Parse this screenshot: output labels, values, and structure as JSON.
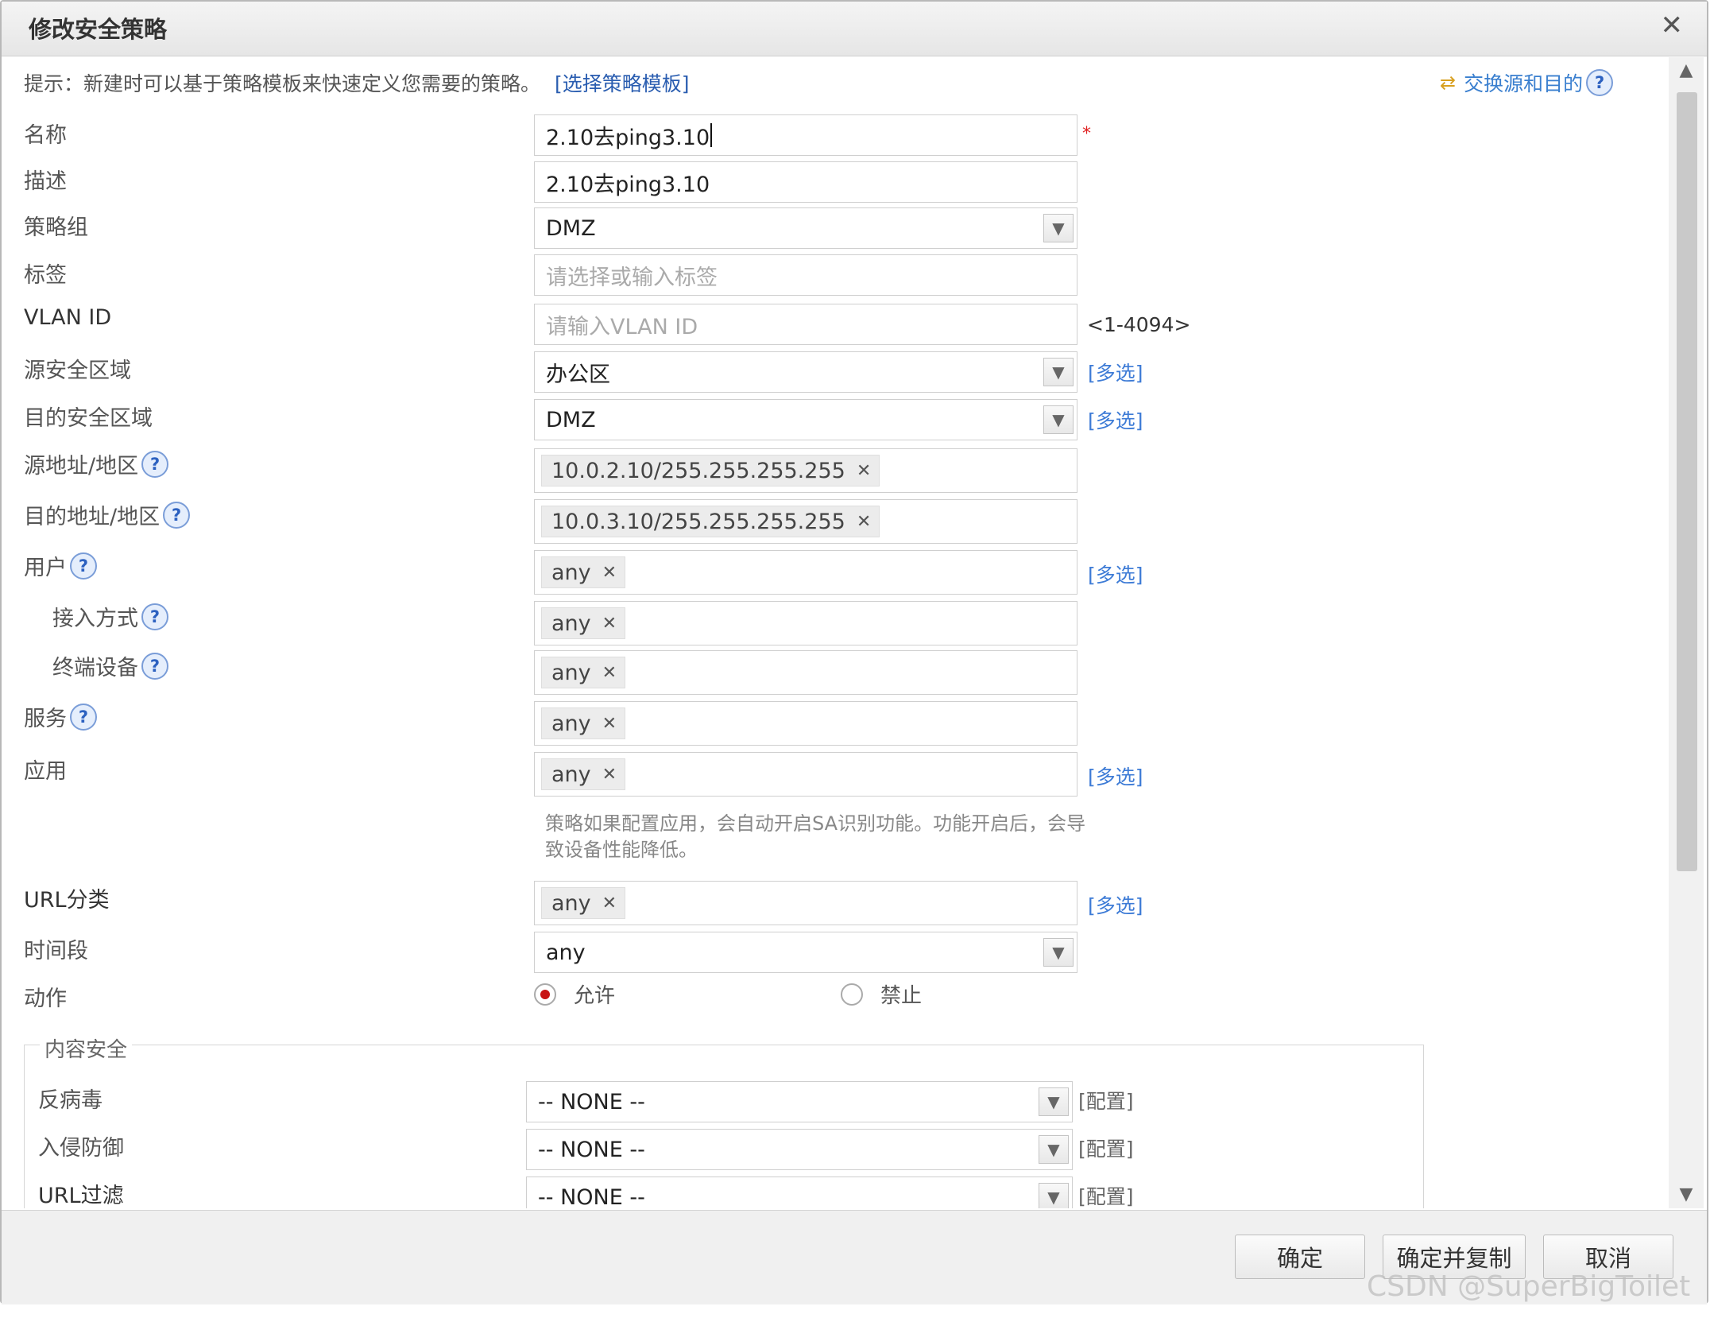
{
  "dialog": {
    "title": "修改安全策略",
    "close_glyph": "✕",
    "hint_text": "提示：新建时可以基于策略模板来快速定义您需要的策略。",
    "hint_link": "[选择策略模板]",
    "swap_label": "交换源和目的",
    "help_glyph": "?"
  },
  "form": {
    "name": {
      "label": "名称",
      "value": "2.10去ping3.10",
      "required_mark": "*"
    },
    "description": {
      "label": "描述",
      "value": "2.10去ping3.10"
    },
    "policy_group": {
      "label": "策略组",
      "value": "DMZ"
    },
    "tag": {
      "label": "标签",
      "placeholder": "请选择或输入标签"
    },
    "vlan_id": {
      "label": "VLAN ID",
      "placeholder": "请输入VLAN ID",
      "range": "<1-4094>"
    },
    "source_zone": {
      "label": "源安全区域",
      "value": "办公区",
      "multi": "[多选]"
    },
    "dest_zone": {
      "label": "目的安全区域",
      "value": "DMZ",
      "multi": "[多选]"
    },
    "source_address": {
      "label": "源地址/地区",
      "tag": "10.0.2.10/255.255.255.255"
    },
    "dest_address": {
      "label": "目的地址/地区",
      "tag": "10.0.3.10/255.255.255.255"
    },
    "user": {
      "label": "用户",
      "tag": "any",
      "multi": "[多选]"
    },
    "access_method": {
      "label": "接入方式",
      "tag": "any"
    },
    "terminal_device": {
      "label": "终端设备",
      "tag": "any"
    },
    "service": {
      "label": "服务",
      "tag": "any"
    },
    "application": {
      "label": "应用",
      "tag": "any",
      "multi": "[多选]"
    },
    "app_note": "策略如果配置应用，会自动开启SA识别功能。功能开启后，会导致设备性能降低。",
    "url_category": {
      "label": "URL分类",
      "tag": "any",
      "multi": "[多选]"
    },
    "time_range": {
      "label": "时间段",
      "value": "any"
    },
    "action": {
      "label": "动作",
      "allow": "允许",
      "deny": "禁止",
      "selected": "允许"
    },
    "tag_remove_glyph": "✕",
    "dropdown_glyph": "▼"
  },
  "content_security": {
    "legend": "内容安全",
    "antivirus": {
      "label": "反病毒",
      "value": "-- NONE --",
      "config": "[配置]"
    },
    "intrusion_prevention": {
      "label": "入侵防御",
      "value": "-- NONE --",
      "config": "[配置]"
    },
    "url_filter": {
      "label": "URL过滤",
      "value": "-- NONE --",
      "config": "[配置]"
    }
  },
  "scrollbar": {
    "up_glyph": "▲",
    "down_glyph": "▼"
  },
  "footer": {
    "ok": "确定",
    "ok_copy": "确定并复制",
    "cancel": "取消"
  },
  "watermark": "CSDN @SuperBigToilet"
}
